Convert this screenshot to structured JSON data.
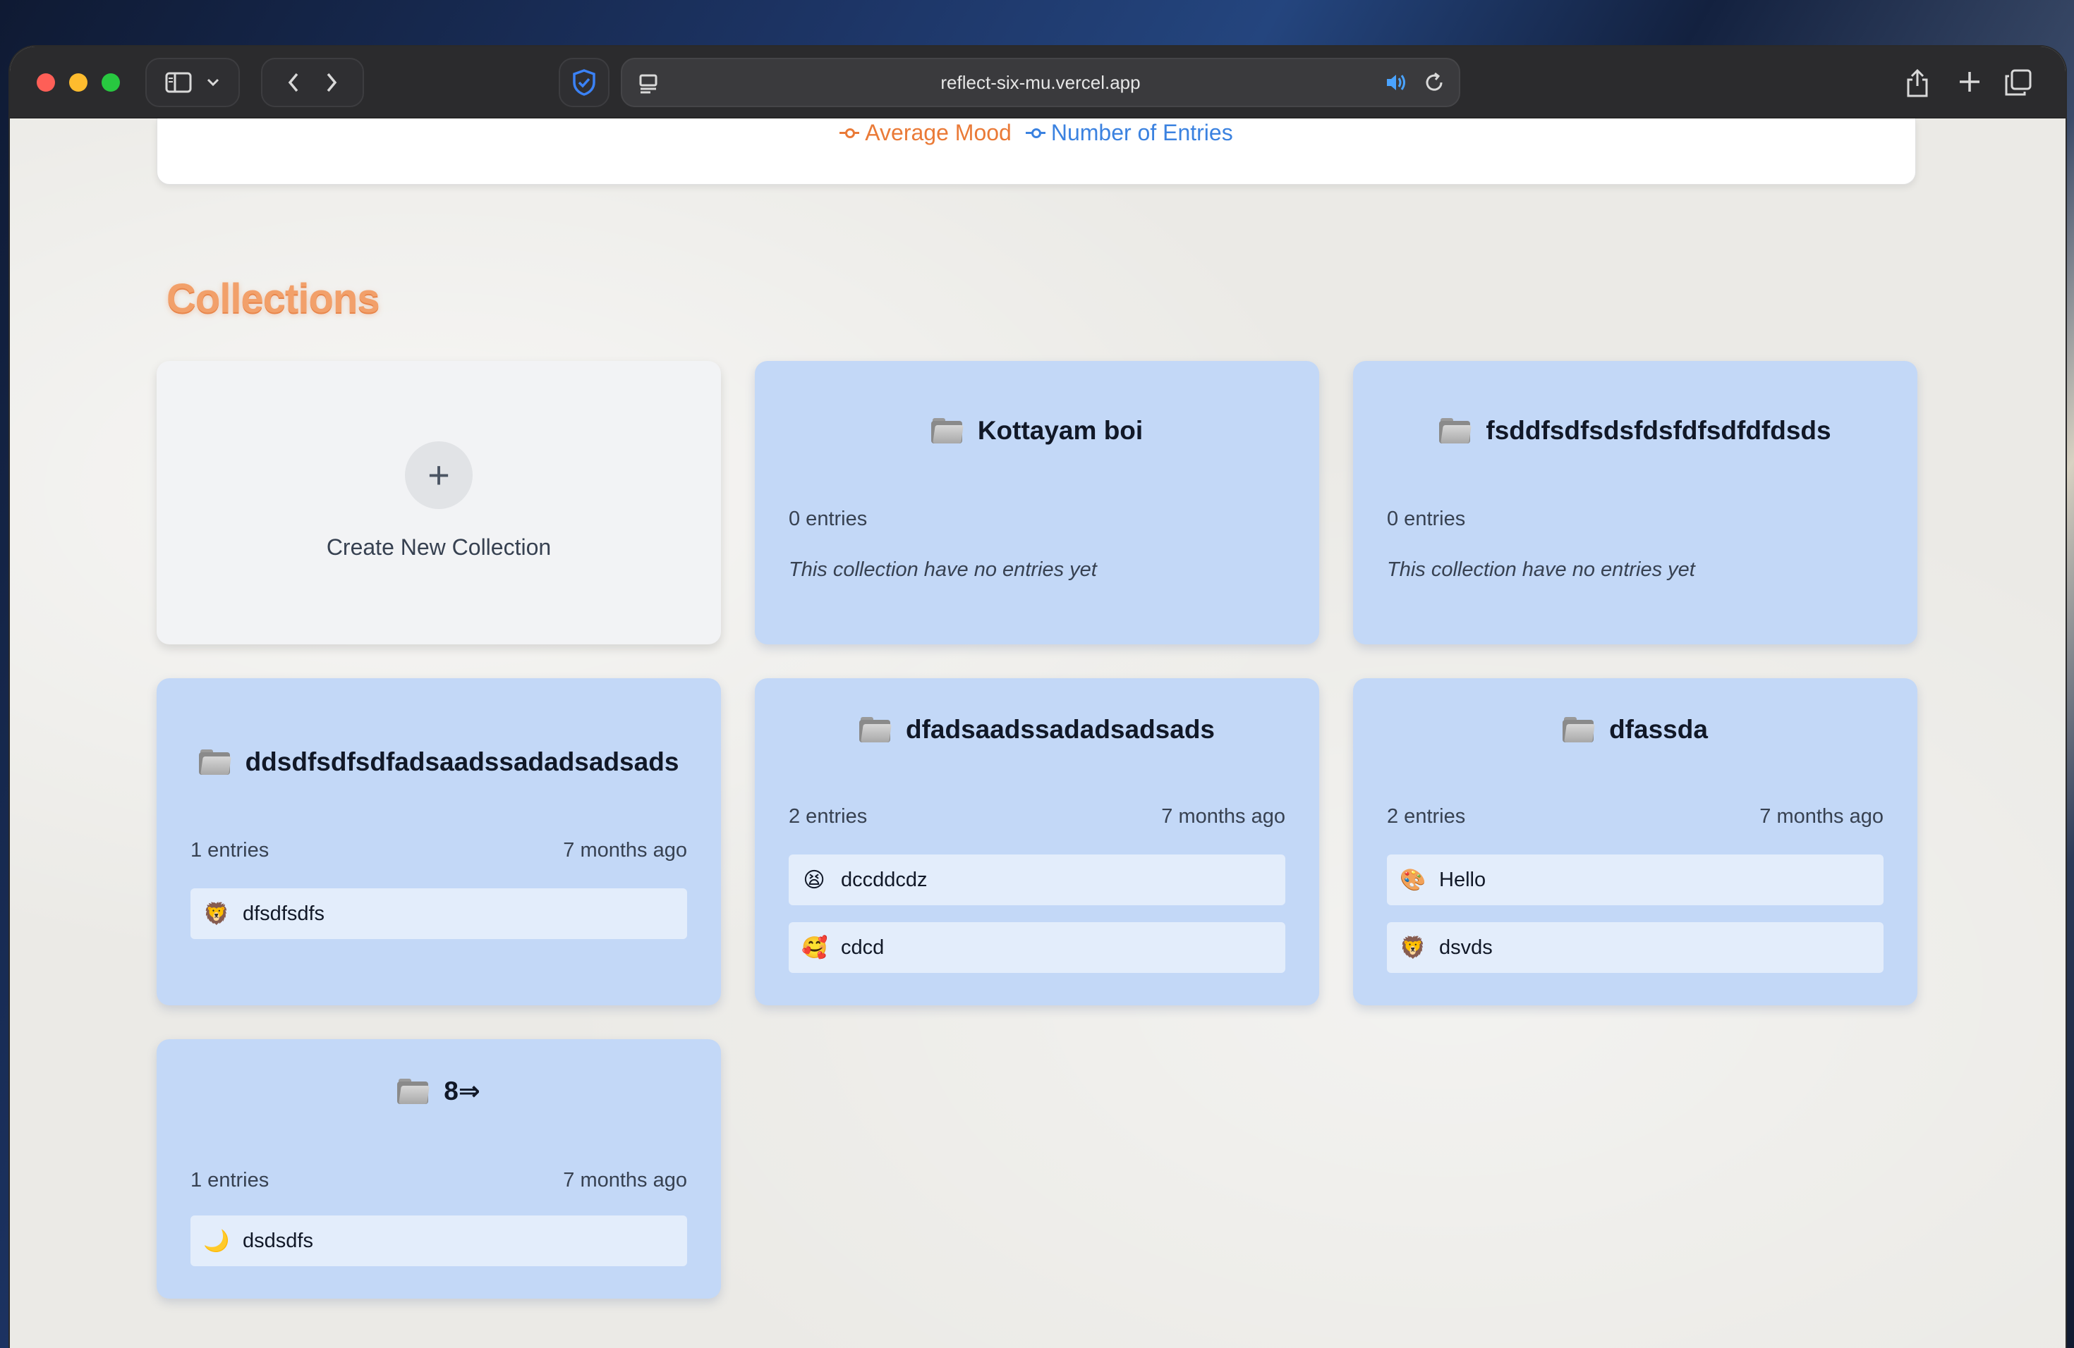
{
  "browser": {
    "url": "reflect-six-mu.vercel.app"
  },
  "chart_legend": {
    "items": [
      {
        "label": "Average Mood",
        "color": "#ea7a37"
      },
      {
        "label": "Number of Entries",
        "color": "#3b82e0"
      }
    ]
  },
  "collections": {
    "title": "Collections",
    "create_label": "Create New Collection",
    "cards": [
      {
        "name": "Kottayam boi",
        "count": "0 entries",
        "updated": "",
        "empty_note": "This collection have no entries yet",
        "entries": []
      },
      {
        "name": "fsddfsdfsdsfdsfdfsdfdfdsds",
        "count": "0 entries",
        "updated": "",
        "empty_note": "This collection have no entries yet",
        "entries": []
      },
      {
        "name": "ddsdfsdfsdfadsaadssadadsadsads",
        "count": "1 entries",
        "updated": "7 months ago",
        "entries": [
          {
            "emoji": "🦁",
            "text": "dfsdfsdfs"
          }
        ]
      },
      {
        "name": "dfadsaadssadadsadsads",
        "count": "2 entries",
        "updated": "7 months ago",
        "entries": [
          {
            "emoji": "😫",
            "text": "dccddcdz"
          },
          {
            "emoji": "🥰",
            "text": "cdcd"
          }
        ]
      },
      {
        "name": "dfassda",
        "count": "2 entries",
        "updated": "7 months ago",
        "entries": [
          {
            "emoji": "🎨",
            "text": "Hello"
          },
          {
            "emoji": "🦁",
            "text": "dsvds"
          }
        ]
      },
      {
        "name": "8⇒",
        "count": "1 entries",
        "updated": "7 months ago",
        "entries": [
          {
            "emoji": "🌙",
            "text": "dsdsdfs"
          }
        ]
      }
    ]
  }
}
